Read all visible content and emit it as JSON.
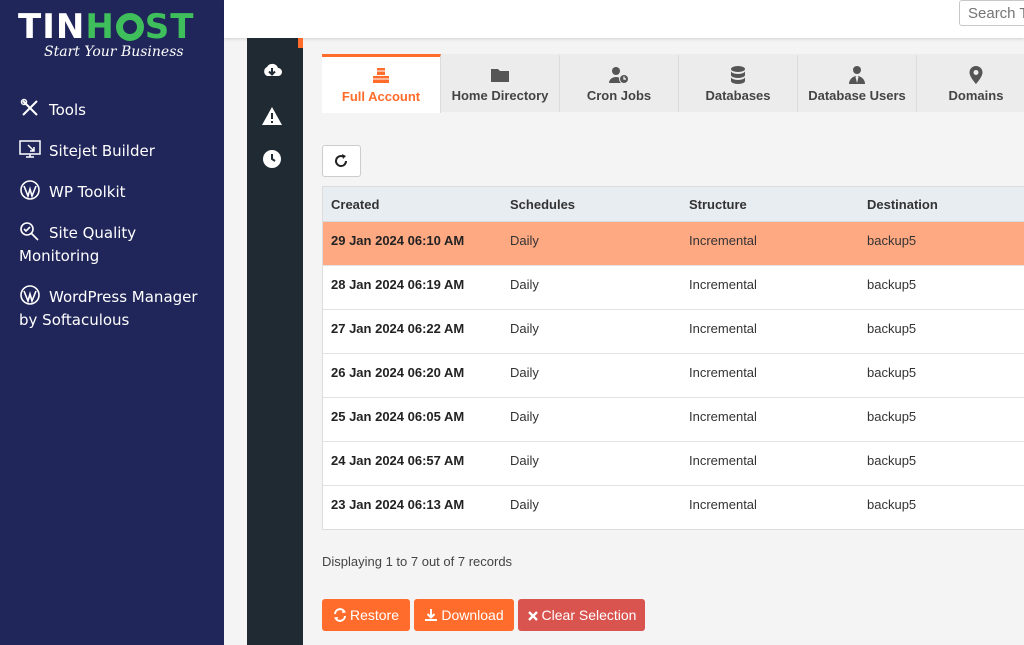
{
  "brand": {
    "name_part1": "TIN",
    "name_part2": "H",
    "name_part3": "ST",
    "tagline": "Start Your Business",
    "green": "#3fbf5b",
    "navy": "#20265a"
  },
  "accent": "#ff6c2c",
  "search": {
    "placeholder": "Search T"
  },
  "sidebar": {
    "items": [
      {
        "label": "Tools",
        "icon": "tools-icon"
      },
      {
        "label": "Sitejet Builder",
        "icon": "sitejet-icon"
      },
      {
        "label": "WP Toolkit",
        "icon": "wordpress-icon"
      },
      {
        "label": "Site Quality Monitoring",
        "icon": "site-quality-icon"
      },
      {
        "label": "WordPress Manager by Softaculous",
        "icon": "wordpress-icon"
      }
    ]
  },
  "rail": {
    "icons": [
      "cloud-download-icon",
      "warning-icon",
      "clock-icon"
    ]
  },
  "tabs": [
    {
      "label": "Full Account",
      "icon": "cubes-icon",
      "active": true
    },
    {
      "label": "Home Directory",
      "icon": "folder-icon",
      "active": false
    },
    {
      "label": "Cron Jobs",
      "icon": "user-clock-icon",
      "active": false
    },
    {
      "label": "Databases",
      "icon": "database-icon",
      "active": false
    },
    {
      "label": "Database Users",
      "icon": "user-tie-icon",
      "active": false
    },
    {
      "label": "Domains",
      "icon": "map-marker-icon",
      "active": false
    }
  ],
  "table": {
    "headers": [
      "Created",
      "Schedules",
      "Structure",
      "Destination"
    ],
    "rows": [
      {
        "created": "29 Jan 2024 06:10 AM",
        "schedule": "Daily",
        "structure": "Incremental",
        "destination": "backup5",
        "selected": true
      },
      {
        "created": "28 Jan 2024 06:19 AM",
        "schedule": "Daily",
        "structure": "Incremental",
        "destination": "backup5",
        "selected": false
      },
      {
        "created": "27 Jan 2024 06:22 AM",
        "schedule": "Daily",
        "structure": "Incremental",
        "destination": "backup5",
        "selected": false
      },
      {
        "created": "26 Jan 2024 06:20 AM",
        "schedule": "Daily",
        "structure": "Incremental",
        "destination": "backup5",
        "selected": false
      },
      {
        "created": "25 Jan 2024 06:05 AM",
        "schedule": "Daily",
        "structure": "Incremental",
        "destination": "backup5",
        "selected": false
      },
      {
        "created": "24 Jan 2024 06:57 AM",
        "schedule": "Daily",
        "structure": "Incremental",
        "destination": "backup5",
        "selected": false
      },
      {
        "created": "23 Jan 2024 06:13 AM",
        "schedule": "Daily",
        "structure": "Incremental",
        "destination": "backup5",
        "selected": false
      }
    ],
    "selected_color": "#ffa983"
  },
  "records_text": "Displaying 1 to 7 out of 7 records",
  "actions": {
    "restore_label": "Restore",
    "download_label": "Download",
    "clear_label": "Clear Selection",
    "clear_color": "#d9534f"
  }
}
